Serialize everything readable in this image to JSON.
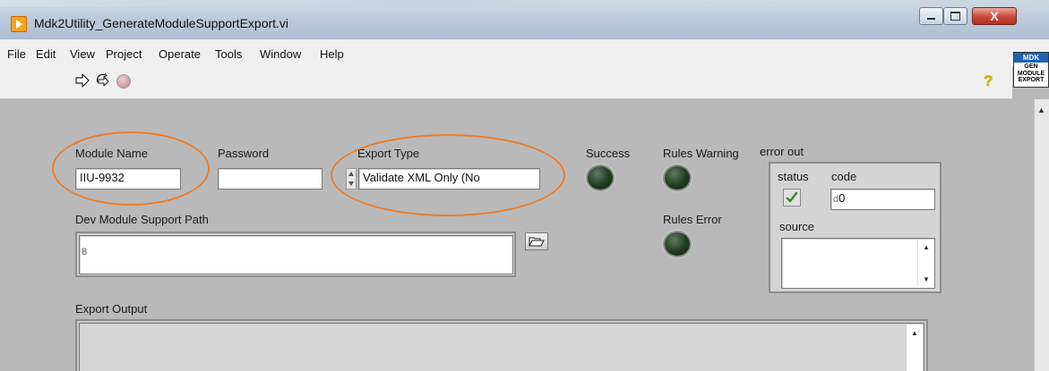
{
  "window": {
    "title": "Mdk2Utility_GenerateModuleSupportExport.vi",
    "close_glyph": "X"
  },
  "menu": [
    "File",
    "Edit",
    "View",
    "Project",
    "Operate",
    "Tools",
    "Window",
    "Help"
  ],
  "vi_icon": {
    "header": "MDK",
    "line1": "GEN",
    "line2": "MODULE",
    "line3": "EXPORT"
  },
  "help_glyph": "?",
  "panel": {
    "module_name": {
      "label": "Module Name",
      "value": "IIU-9932"
    },
    "password": {
      "label": "Password",
      "value": ""
    },
    "export_type": {
      "label": "Export Type",
      "value": "Validate XML Only (No"
    },
    "success": {
      "label": "Success"
    },
    "rules_warning": {
      "label": "Rules Warning"
    },
    "rules_error": {
      "label": "Rules Error"
    },
    "dev_module_support_path": {
      "label": "Dev Module Support Path",
      "path_prefix": "8",
      "value": ""
    },
    "export_output": {
      "label": "Export Output",
      "value": ""
    },
    "error_out": {
      "label": "error out",
      "status_label": "status",
      "code_label": "code",
      "code_prefix": "d",
      "code_value": "0",
      "source_label": "source",
      "source_value": ""
    }
  },
  "colors": {
    "panel": "#b9b9b9",
    "highlight_oval": "#ea7d2b",
    "led_off": "#1f3b1f"
  }
}
